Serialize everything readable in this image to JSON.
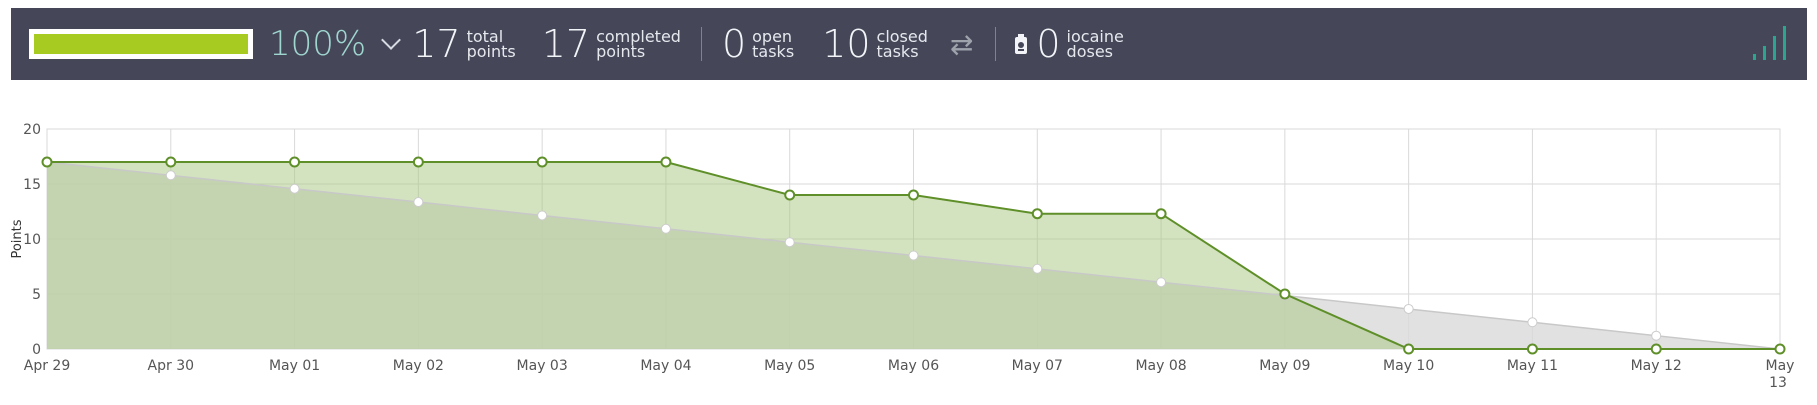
{
  "summary": {
    "progress_percent": 100,
    "percent_label": "100%",
    "total_points": {
      "value": "17",
      "label_line1": "total",
      "label_line2": "points"
    },
    "completed_points": {
      "value": "17",
      "label_line1": "completed",
      "label_line2": "points"
    },
    "open_tasks": {
      "value": "0",
      "label_line1": "open",
      "label_line2": "tasks"
    },
    "closed_tasks": {
      "value": "10",
      "label_line1": "closed",
      "label_line2": "tasks"
    },
    "iocaine_doses": {
      "value": "0",
      "label_line1": "iocaine",
      "label_line2": "doses"
    },
    "icons": [
      "chevron-down-icon",
      "swap-arrows-icon",
      "iocaine-bottle-icon",
      "signal-bars-icon"
    ],
    "colors": {
      "bar_bg": "#454759",
      "progress": "#a8cb22",
      "percent": "#9fd6cf",
      "signal": "#2aa58f"
    }
  },
  "chart_data": {
    "type": "area",
    "title": "",
    "xlabel": "",
    "ylabel": "Points",
    "categories": [
      "Apr 29",
      "Apr 30",
      "May 01",
      "May 02",
      "May 03",
      "May 04",
      "May 05",
      "May 06",
      "May 07",
      "May 08",
      "May 09",
      "May 10",
      "May 11",
      "May 12",
      "May 13"
    ],
    "ylim": [
      0,
      20
    ],
    "yticks": [
      0,
      5,
      10,
      15,
      20
    ],
    "grid": true,
    "series": [
      {
        "role": "optimal",
        "color": "#c8c8c8",
        "values": [
          17,
          15.79,
          14.57,
          13.36,
          12.14,
          10.93,
          9.71,
          8.5,
          7.29,
          6.07,
          4.86,
          3.64,
          2.43,
          1.21,
          0
        ]
      },
      {
        "role": "actual",
        "color": "#5f8f29",
        "fill": "#bdd5a0",
        "values": [
          17,
          17,
          17,
          17,
          17,
          17,
          14,
          14,
          12.3,
          12.3,
          5,
          0,
          0,
          0,
          0
        ]
      }
    ]
  }
}
